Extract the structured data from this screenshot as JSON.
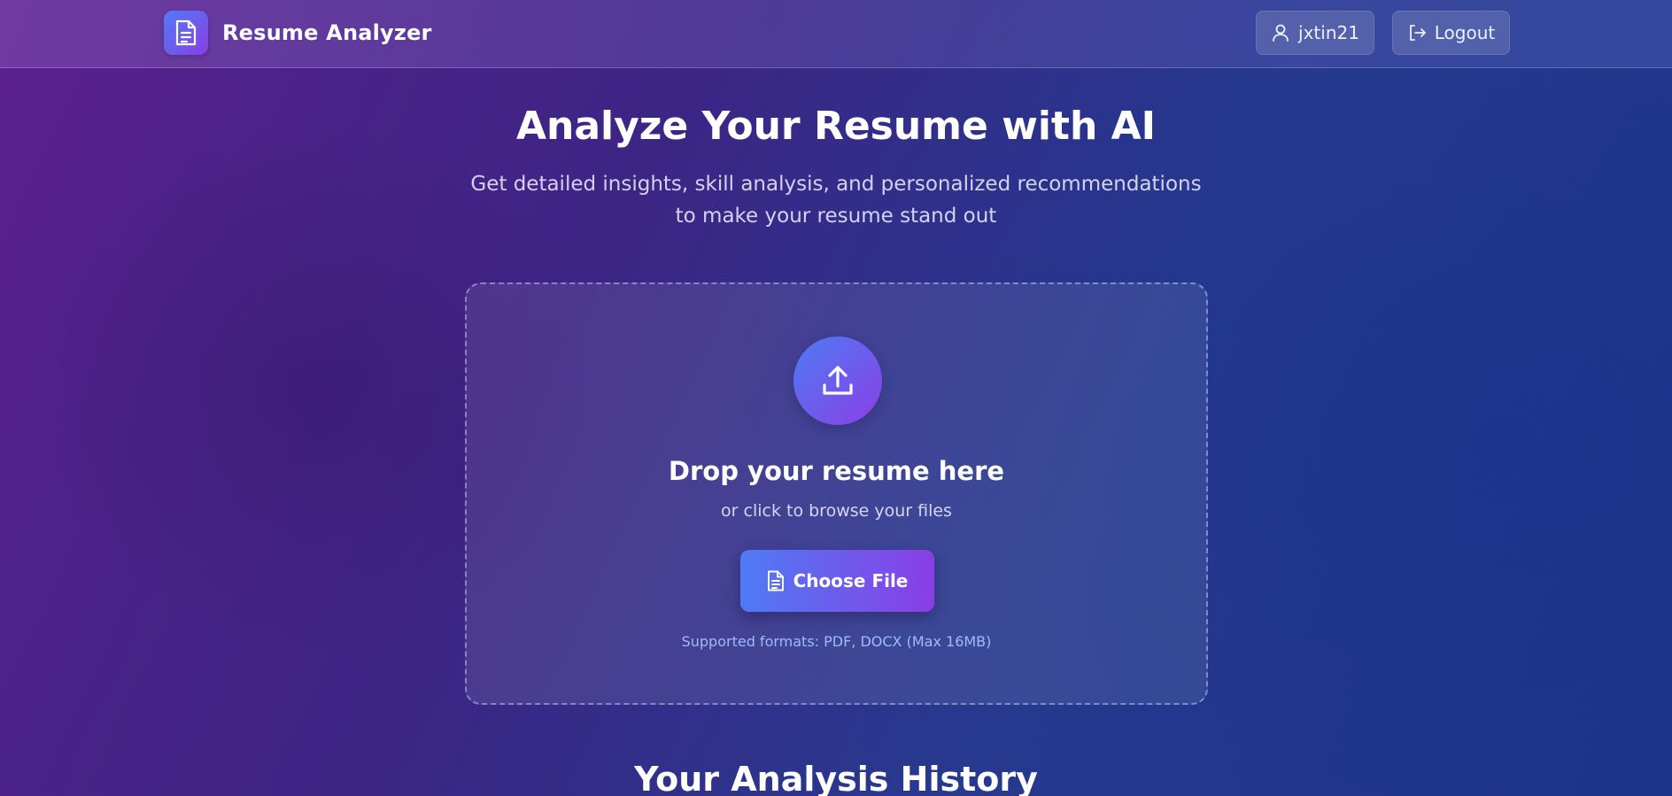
{
  "header": {
    "app_title": "Resume Analyzer",
    "logo_icon": "document-icon",
    "username": "jxtin21",
    "user_icon": "user-icon",
    "logout_label": "Logout",
    "logout_icon": "logout-icon"
  },
  "hero": {
    "title": "Analyze Your Resume with AI",
    "subtitle": "Get detailed insights, skill analysis, and personalized recommendations to make your resume stand out"
  },
  "upload": {
    "icon": "upload-icon",
    "title": "Drop your resume here",
    "subtitle": "or click to browse your files",
    "button_label": "Choose File",
    "button_icon": "document-icon",
    "formats": "Supported formats: PDF, DOCX (Max 16MB)"
  },
  "history": {
    "title": "Your Analysis History"
  },
  "colors": {
    "accent_start": "#4f7bf5",
    "accent_end": "#8a3ee6"
  }
}
